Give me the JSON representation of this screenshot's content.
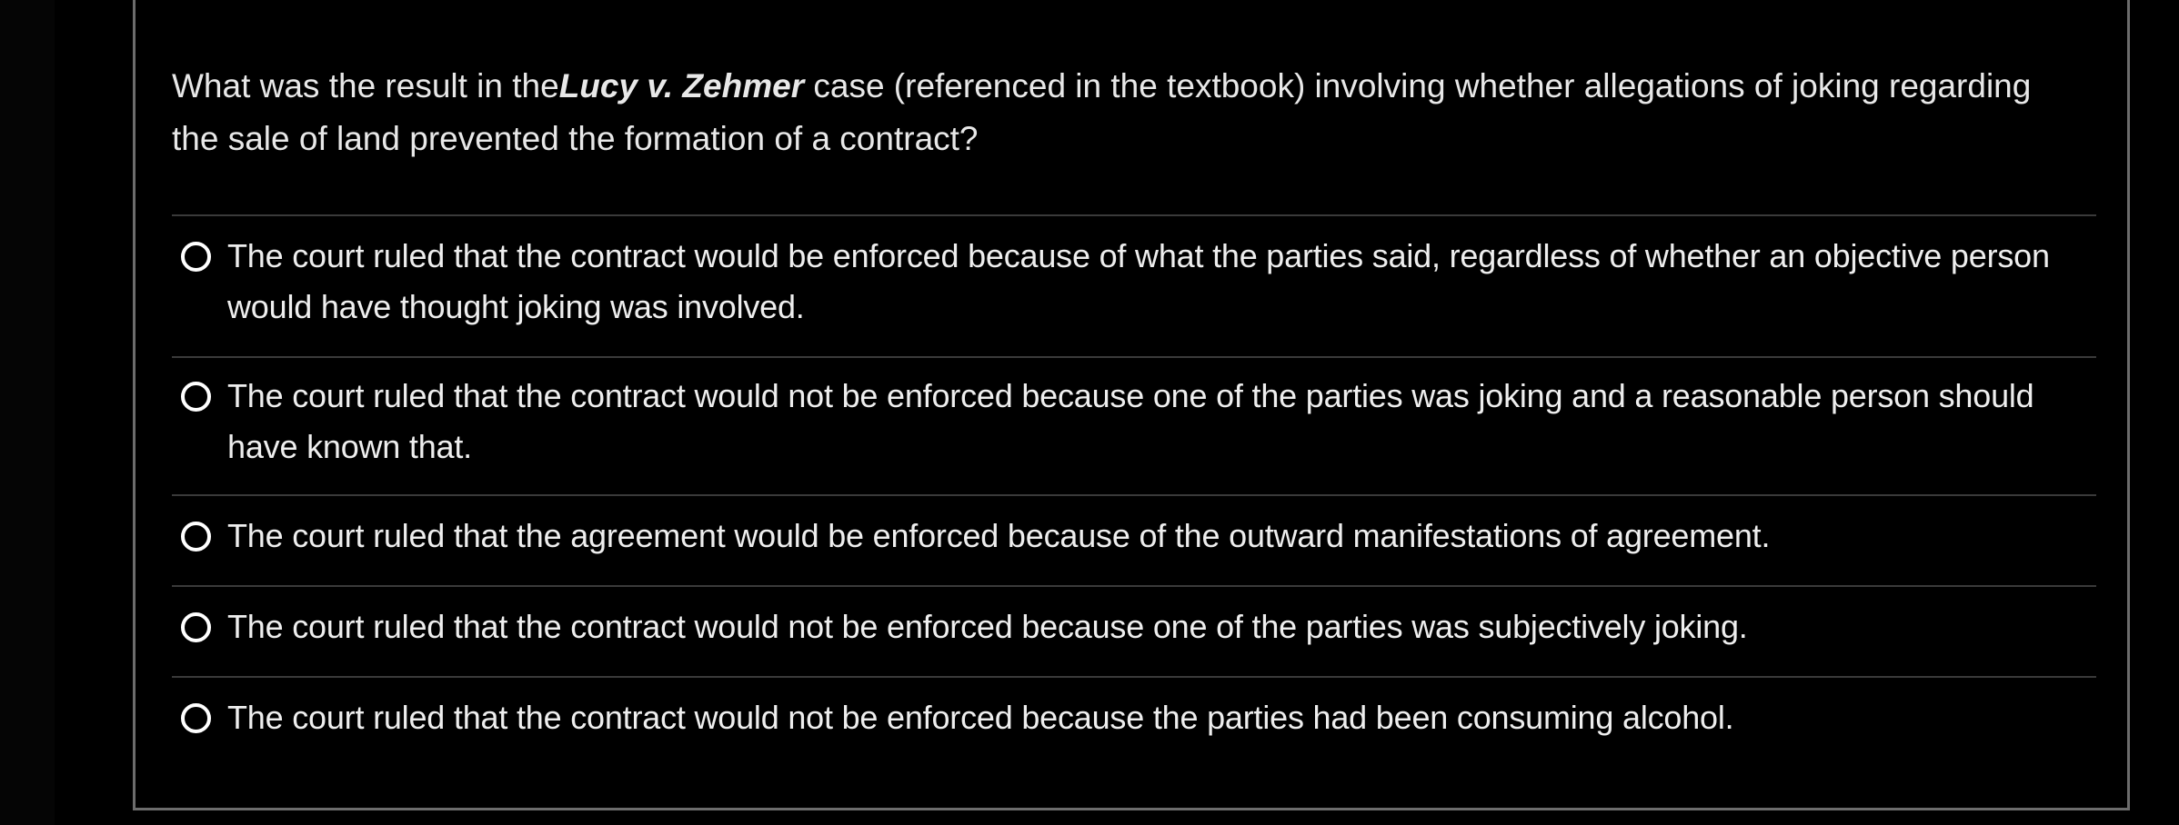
{
  "question": {
    "prefix": "What was the result in the",
    "case_name": "Lucy v. Zehmer",
    "suffix": " case (referenced in the textbook) involving whether allegations of joking regarding the sale of land prevented the formation of a contract?"
  },
  "options": [
    {
      "label": "The court ruled that the contract would be enforced because of what the parties said, regardless of whether an objective person would have thought joking was involved.",
      "selected": false
    },
    {
      "label": "The court ruled that the contract would not be enforced because one of the parties was joking and a reasonable person should have known that.",
      "selected": false
    },
    {
      "label": "The court ruled that the agreement would be enforced because of the outward manifestations of agreement.",
      "selected": false
    },
    {
      "label": "The court ruled that the contract would not be enforced because one of the parties was subjectively joking.",
      "selected": false
    },
    {
      "label": "The court ruled that the contract would not be enforced because the parties had been consuming alcohol.",
      "selected": false
    }
  ],
  "colors": {
    "background": "#000000",
    "text": "#eeeeee",
    "divider": "#3a3a3a",
    "card_border": "#6c6c6c",
    "radio_border": "#ffffff"
  }
}
